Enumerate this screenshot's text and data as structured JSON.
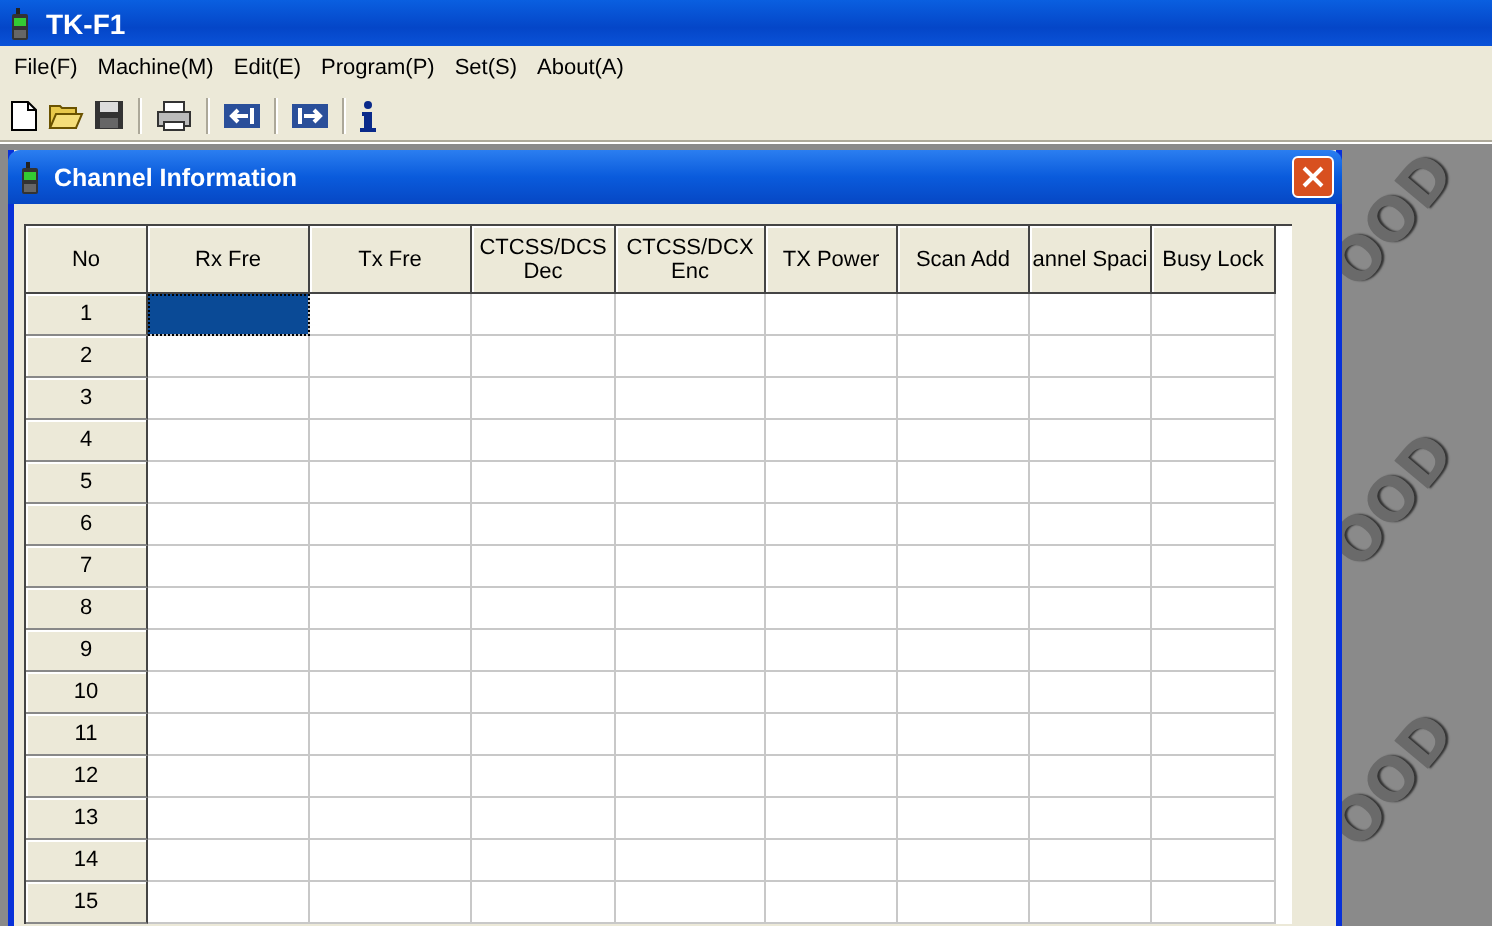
{
  "window": {
    "title": "TK-F1"
  },
  "menu": [
    "File(F)",
    "Machine(M)",
    "Edit(E)",
    "Program(P)",
    "Set(S)",
    "About(A)"
  ],
  "toolbar": [
    {
      "kind": "new"
    },
    {
      "kind": "open"
    },
    {
      "kind": "save"
    },
    {
      "kind": "sep"
    },
    {
      "kind": "print"
    },
    {
      "kind": "sep"
    },
    {
      "kind": "read"
    },
    {
      "kind": "sep"
    },
    {
      "kind": "write"
    },
    {
      "kind": "sep"
    },
    {
      "kind": "info"
    }
  ],
  "background_marks": [
    "OOD",
    "OOD",
    "OOD"
  ],
  "child_window": {
    "title": "Channel Information",
    "table": {
      "columns": [
        {
          "label": "No"
        },
        {
          "label": "Rx Fre"
        },
        {
          "label": "Tx Fre"
        },
        {
          "label": "CTCSS/DCS Dec"
        },
        {
          "label": "CTCSS/DCX Enc"
        },
        {
          "label": "TX Power"
        },
        {
          "label": "Scan Add"
        },
        {
          "label": "annel Spaci"
        },
        {
          "label": "Busy Lock"
        }
      ],
      "rows": [
        {
          "no": "1",
          "rx_selected": true
        },
        {
          "no": "2",
          "rx_selected": false
        },
        {
          "no": "3",
          "rx_selected": false
        },
        {
          "no": "4",
          "rx_selected": false
        },
        {
          "no": "5",
          "rx_selected": false
        },
        {
          "no": "6",
          "rx_selected": false
        },
        {
          "no": "7",
          "rx_selected": false
        },
        {
          "no": "8",
          "rx_selected": false
        },
        {
          "no": "9",
          "rx_selected": false
        },
        {
          "no": "10",
          "rx_selected": false
        },
        {
          "no": "11",
          "rx_selected": false
        },
        {
          "no": "12",
          "rx_selected": false
        },
        {
          "no": "13",
          "rx_selected": false
        },
        {
          "no": "14",
          "rx_selected": false
        },
        {
          "no": "15",
          "rx_selected": false
        }
      ]
    }
  }
}
